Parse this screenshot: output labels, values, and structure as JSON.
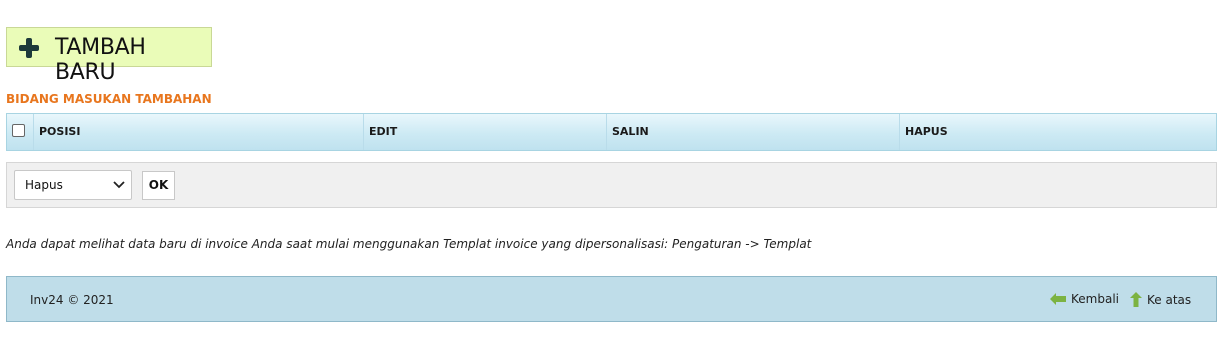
{
  "toolbar": {
    "add_new_label": "TAMBAH BARU"
  },
  "section": {
    "title": "BIDANG MASUKAN TAMBAHAN"
  },
  "table": {
    "columns": [
      "POSISI",
      "EDIT",
      "SALIN",
      "HAPUS"
    ]
  },
  "bulk_action": {
    "selected": "Hapus",
    "ok_label": "OK"
  },
  "note": "Anda dapat melihat data baru di invoice Anda saat mulai menggunakan Templat invoice yang dipersonalisasi: Pengaturan -> Templat",
  "footer": {
    "copyright": "Inv24 © 2021",
    "back_label": "Kembali",
    "top_label": "Ke atas"
  },
  "colors": {
    "add_button_bg": "#eafcb8",
    "section_title": "#e8761e",
    "footer_bg": "#bfdde9",
    "arrow_green": "#7cb342"
  },
  "icons": [
    "plus-icon",
    "chevron-down-icon",
    "arrow-left-icon",
    "arrow-up-icon"
  ]
}
